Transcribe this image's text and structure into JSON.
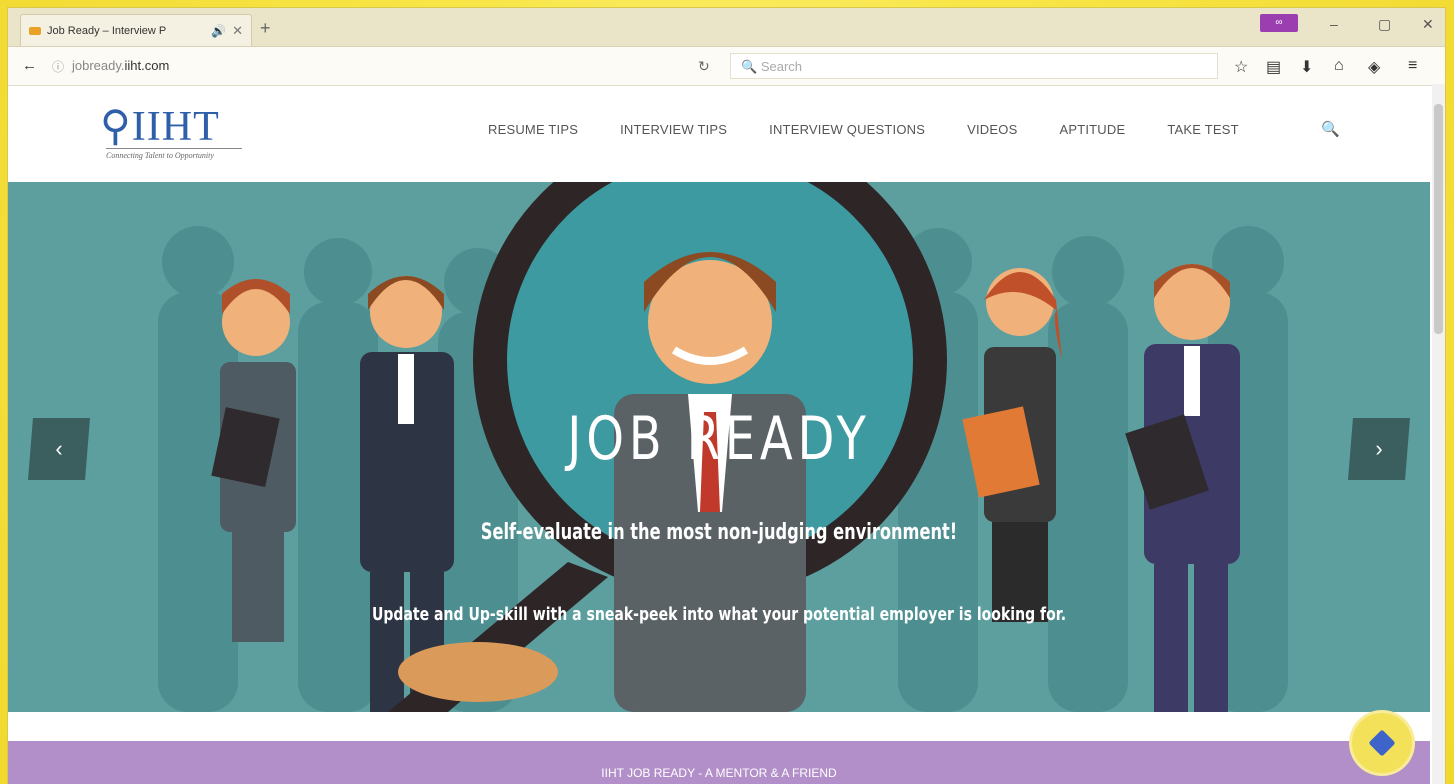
{
  "browser": {
    "tab_title": "Job Ready – Interview P",
    "tab_sound_icon": "speaker-icon",
    "tab_close": "✕",
    "new_tab": "+",
    "url_prefix": "jobready.",
    "url_domain": "iiht.com",
    "search_placeholder": "Search",
    "reload": "↻",
    "back": "←",
    "win_min": "–",
    "win_max": "▢",
    "win_close": "✕",
    "privbadge": "∞"
  },
  "site": {
    "logo_text": "IIHT",
    "logo_tagline": "Connecting Talent to Opportunity",
    "menu": [
      "RESUME TIPS",
      "INTERVIEW TIPS",
      "INTERVIEW QUESTIONS",
      "VIDEOS",
      "APTITUDE",
      "TAKE TEST"
    ]
  },
  "hero": {
    "title": "JOB READY",
    "subtitle": "Self-evaluate in the most non-judging environment!",
    "body": "Update and Up-skill with a sneak-peek into what your potential employer is looking for.",
    "prev": "‹",
    "next": "›"
  },
  "band": {
    "text": "IIHT JOB READY - A MENTOR & A FRIEND"
  },
  "colors": {
    "hero_bg": "#5d9e9f",
    "band": "#b28fc8",
    "logo": "#2f5fa8"
  }
}
